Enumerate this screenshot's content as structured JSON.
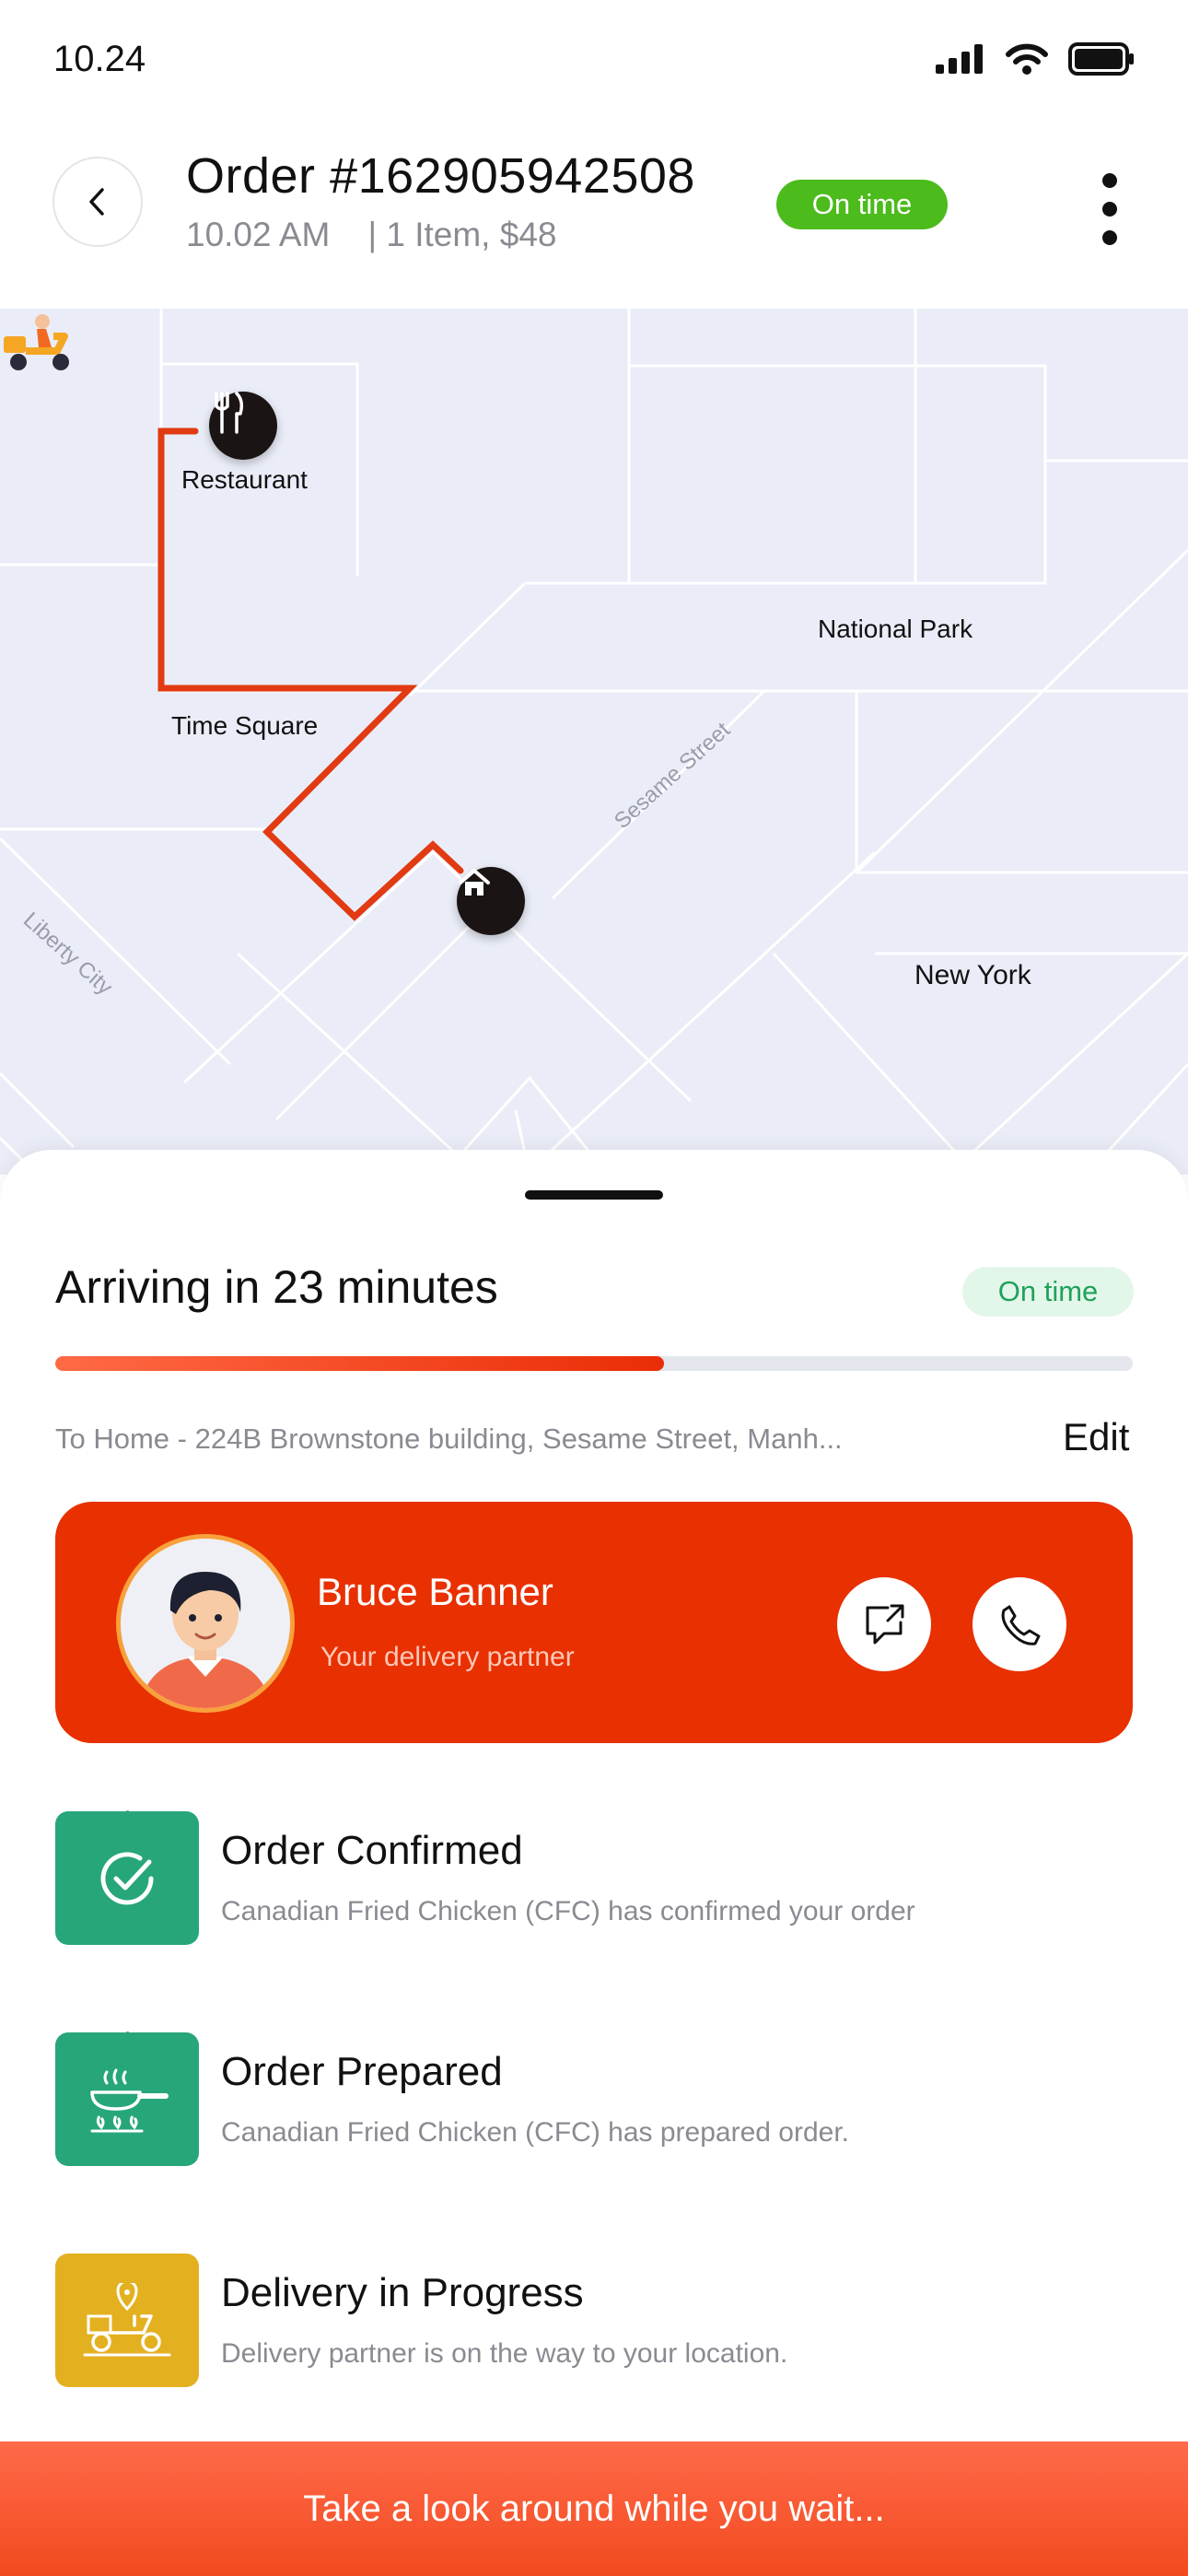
{
  "status_bar": {
    "time": "10.24",
    "icons": [
      "signal-icon",
      "wifi-icon",
      "battery-icon"
    ]
  },
  "header": {
    "order_title": "Order #162905942508",
    "order_time": "10.02 AM",
    "order_summary": "| 1 Item, $48",
    "status_pill": "On time",
    "status_color": "#4cbb1c"
  },
  "map": {
    "places": {
      "restaurant": "Restaurant",
      "time_square": "Time Square",
      "national_park": "National Park",
      "new_york": "New York"
    },
    "streets": {
      "sesame": "Sesame Street",
      "liberty": "Liberty City"
    },
    "route_color": "#e23a12",
    "pins": [
      "restaurant-pin-icon",
      "home-pin-icon",
      "scooter-icon"
    ]
  },
  "sheet": {
    "arriving_text": "Arriving in 23 minutes",
    "status_pill": "On time",
    "progress": 0.565,
    "address": "To Home - 224B Brownstone building,  Sesame Street, Manh...",
    "edit_label": "Edit"
  },
  "partner": {
    "name": "Bruce Banner",
    "role": "Your delivery partner",
    "card_color": "#e83000"
  },
  "steps": [
    {
      "title": "Order Confirmed",
      "desc": "Canadian Fried Chicken (CFC) has confirmed your order",
      "color": "#27a679",
      "icon": "check-circle-icon"
    },
    {
      "title": "Order Prepared",
      "desc": "Canadian Fried Chicken (CFC) has prepared order.",
      "color": "#27a679",
      "icon": "cooking-pan-icon"
    },
    {
      "title": "Delivery in Progress",
      "desc": "Delivery partner is on the way to your location.",
      "color": "#e3b020",
      "icon": "delivery-scooter-icon"
    }
  ],
  "cta": {
    "label": "Take a look around while you wait..."
  }
}
